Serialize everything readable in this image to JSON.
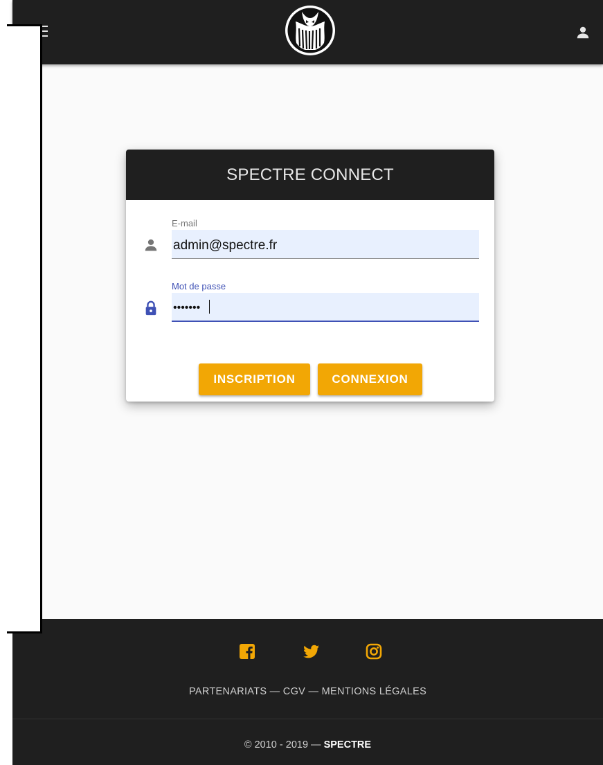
{
  "header": {
    "menu_icon": "menu-icon",
    "logo_icon": "spectre-octopus-logo",
    "account_icon": "account-icon"
  },
  "login": {
    "title": "SPECTRE CONNECT",
    "email": {
      "label": "E-mail",
      "value": "admin@spectre.fr",
      "icon": "person-icon"
    },
    "password": {
      "label": "Mot de passe",
      "value": "•••••••",
      "icon": "lock-icon"
    },
    "signup_label": "INSCRIPTION",
    "login_label": "CONNEXION"
  },
  "footer": {
    "social_icons": [
      "facebook-icon",
      "twitter-icon",
      "instagram-icon"
    ],
    "links": [
      "PARTENARIATS",
      "CGV",
      "MENTIONS LÉGALES"
    ],
    "link_separator": " — ",
    "copyright_prefix": "© 2010 - 2019 — ",
    "copyright_brand": "SPECTRE"
  },
  "colors": {
    "header_bg": "#1f1f1f",
    "accent": "#f2a705",
    "focus": "#3f51b5",
    "autofill_bg": "#e8f0fe",
    "page_bg": "#fafafa"
  }
}
